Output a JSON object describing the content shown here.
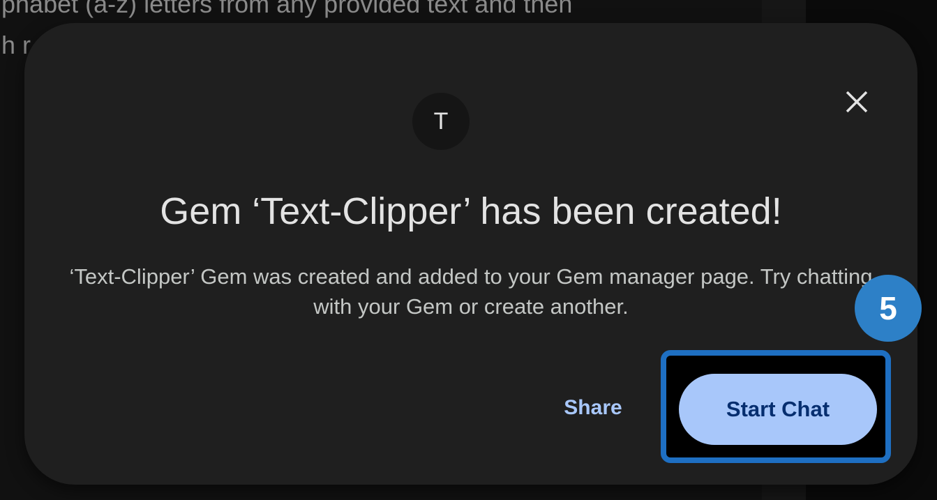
{
  "background": {
    "text_line_1": "phabet (a-z) letters from any provided text and then",
    "text_line_2": "h r"
  },
  "dialog": {
    "close_icon": "close-icon",
    "avatar_letter": "T",
    "title": "Gem ‘Text-Clipper’ has been created!",
    "description": "‘Text-Clipper’ Gem was created and added to your Gem manager page. Try chatting with your Gem or create another.",
    "share_label": "Share",
    "start_chat_label": "Start Chat"
  },
  "annotation": {
    "step_number": "5"
  },
  "colors": {
    "dialog_bg": "#1f1f1f",
    "primary_button": "#a8c7fa",
    "primary_button_text": "#062e6f",
    "highlight_border": "#1e6fc2",
    "badge": "#2d80c7"
  }
}
